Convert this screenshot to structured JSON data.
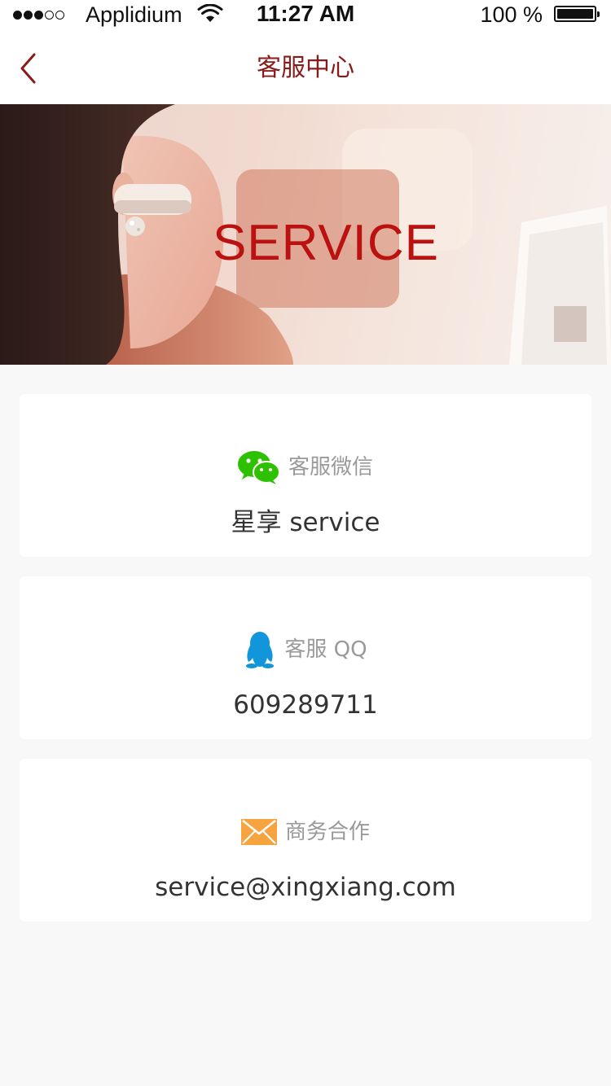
{
  "status_bar": {
    "carrier": "Applidium",
    "time": "11:27 AM",
    "battery": "100 %",
    "signal_dots_filled": 3,
    "signal_dots_total": 5
  },
  "nav": {
    "back_icon": "chevron-left-icon",
    "title": "客服中心"
  },
  "banner": {
    "text": "SERVICE"
  },
  "contacts": [
    {
      "icon": "wechat-icon",
      "label": "客服微信",
      "value": "星享 service"
    },
    {
      "icon": "qq-penguin-icon",
      "label": "客服 QQ",
      "value": "609289711"
    },
    {
      "icon": "envelope-icon",
      "label": "商务合作",
      "value": "service@xingxiang.com"
    }
  ],
  "colors": {
    "title": "#8b1a1a",
    "banner_text": "#bb1111",
    "wechat": "#2dc100",
    "qq": "#1296db",
    "envelope": "#f7a440",
    "page_bg": "#f8f8f8"
  }
}
